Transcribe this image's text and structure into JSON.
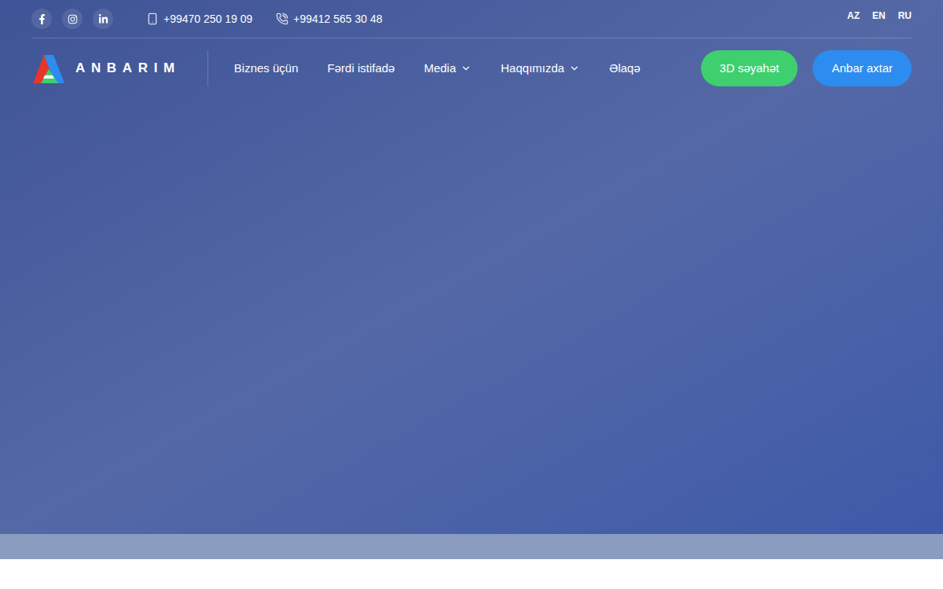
{
  "contacts": [
    {
      "kind": "mobile",
      "number": "+99470 250 19 09"
    },
    {
      "kind": "landline",
      "number": "+99412 565 30 48"
    }
  ],
  "languages": [
    {
      "label": "AZ"
    },
    {
      "label": "EN"
    },
    {
      "label": "RU"
    }
  ],
  "logo": {
    "text": "ANBARIM"
  },
  "nav": [
    {
      "label": "Biznes üçün",
      "dropdown": false
    },
    {
      "label": "Fərdi istifadə",
      "dropdown": false
    },
    {
      "label": "Media",
      "dropdown": true
    },
    {
      "label": "Haqqımızda",
      "dropdown": true
    },
    {
      "label": "Əlaqə",
      "dropdown": false
    }
  ],
  "buttons": [
    {
      "label": "3D səyahət",
      "color": "#3ecf6e"
    },
    {
      "label": "Anbar axtar",
      "color": "#2d8cf0"
    }
  ]
}
